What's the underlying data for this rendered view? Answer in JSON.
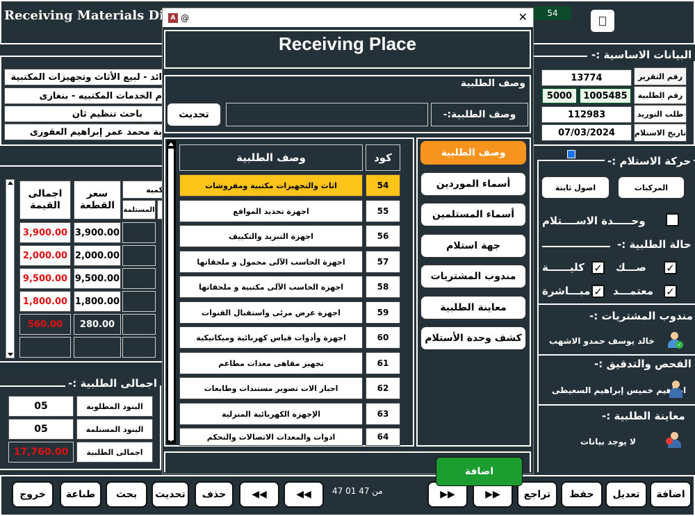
{
  "window": {
    "title": "Receiving Materials Direc",
    "badge": "54"
  },
  "basic": {
    "section_title": "البيانات الاساسية :-",
    "fields": [
      {
        "label": "رقم التقرير",
        "value": "13774"
      },
      {
        "label": "رقم الطلبية",
        "value": "1005485",
        "extra": "5000"
      },
      {
        "label": "طلب التوريد",
        "value": "112983"
      },
      {
        "label": "تاريخ الاستلام",
        "value": "07/03/2024"
      }
    ],
    "left_texts": [
      "ائد - لبيع الأثاث وتجهيزات المكتبية",
      "م الخدمات المكتبيه - بنغازى",
      "باحث تنظيم ثان",
      "بة محمد عمر إبراهيم العقورى"
    ]
  },
  "movement": {
    "title": "حركة الاستلام :-",
    "btn_vehicles": "المركبات",
    "btn_fixed": "اصول ثابتة",
    "unit_label": "وحـــــدة الاســــتلام",
    "status_title": "حالة الطلبية :-",
    "status_items": [
      {
        "label": "صـــك",
        "checked": true
      },
      {
        "label": "كليــــــة",
        "checked": true
      },
      {
        "label": "معتمـــد",
        "checked": true
      },
      {
        "label": "مبـــاشرة",
        "checked": true
      }
    ]
  },
  "purchases_rep": {
    "title": "مندوب المشتريات :-",
    "name": "خالد يوسف حمدو الاشهب"
  },
  "inspection": {
    "title": "الفحص والتدقيق :-",
    "name": "ابراهيم خميس إبراهيم السعيطى"
  },
  "preview": {
    "title": "معاينة الطلبية :-",
    "name": "لا يوجد بيانات"
  },
  "items_table": {
    "headers": {
      "total": "اجمالى القيمة",
      "price": "سعر القطعة",
      "qty": "كمية",
      "received": "المستلمة"
    },
    "rows": [
      {
        "total": "3,900.00",
        "price": "3,900.00"
      },
      {
        "total": "2,000.00",
        "price": "2,000.00"
      },
      {
        "total": "9,500.00",
        "price": "9,500.00"
      },
      {
        "total": "1,800.00",
        "price": "1,800.00"
      },
      {
        "total": "560.00",
        "price": "280.00"
      },
      {
        "total": "",
        "price": ""
      }
    ]
  },
  "totals": {
    "title": "اجمالى الطلبية :-",
    "rows": [
      {
        "label": "البنود المطلوبة",
        "value": "05"
      },
      {
        "label": "البنود المستلمة",
        "value": "05"
      },
      {
        "label": "اجمالى الطلبية",
        "value": "17,760.00"
      }
    ]
  },
  "toolbar": {
    "exit": "خروج",
    "print": "طباعة",
    "search": "بحث",
    "refresh": "تحديث",
    "delete": "حذف",
    "undo": "تراجع",
    "save": "حفظ",
    "edit": "تعديل",
    "add": "اضافة",
    "record_info": "47 من 47 01"
  },
  "dialog": {
    "title": "@",
    "heading": "Receiving Place",
    "desc_section": "وصف الطلبية",
    "desc_label": "وصف الطلبية:-",
    "desc_value": "",
    "refresh_btn": "تحديث",
    "col_code": "كود",
    "col_desc": "وصف الطلبية",
    "rows": [
      {
        "code": "54",
        "desc": "اثاث والتجهيزات مكتبية ومفروشات",
        "selected": true
      },
      {
        "code": "55",
        "desc": "اجهزة تحديد المواقع"
      },
      {
        "code": "56",
        "desc": "اجهزة التبريد والتكييف"
      },
      {
        "code": "57",
        "desc": "اجهزة الحاسب الآلى محمول و ملحقاتها"
      },
      {
        "code": "58",
        "desc": "اجهزة الحاسب الآلى  مكتبية و ملحقاتها"
      },
      {
        "code": "59",
        "desc": "اجهزة عرض مرئى واستقبال القنوات"
      },
      {
        "code": "60",
        "desc": "اجهزة وأدوات قياس كهربائية وميكانيكية"
      },
      {
        "code": "61",
        "desc": "تجهيز مقاهى معدات مطاعم"
      },
      {
        "code": "62",
        "desc": "احبار الات تصوير مستندات وطابعات"
      },
      {
        "code": "63",
        "desc": "الإجهزة الكهربائية المنزلية"
      },
      {
        "code": "64",
        "desc": "ادوات والمعدات الاتصالات والتحكم"
      }
    ],
    "menu": [
      {
        "label": "وصف الطلبية",
        "active": true
      },
      {
        "label": "أسماء  الموردين"
      },
      {
        "label": "أسماء المستلمين"
      },
      {
        "label": "جهة استلام"
      },
      {
        "label": "مندوب المشتريات"
      },
      {
        "label": "معاينة الطلبية"
      },
      {
        "label": "كشف وحدة الأستلام"
      }
    ],
    "add_btn": "اضافة"
  },
  "colors": {
    "bg": "#243139",
    "accent": "#f7941d",
    "selected_row": "#fcc419",
    "add_green": "#1b9e2f",
    "red": "#e01010"
  }
}
